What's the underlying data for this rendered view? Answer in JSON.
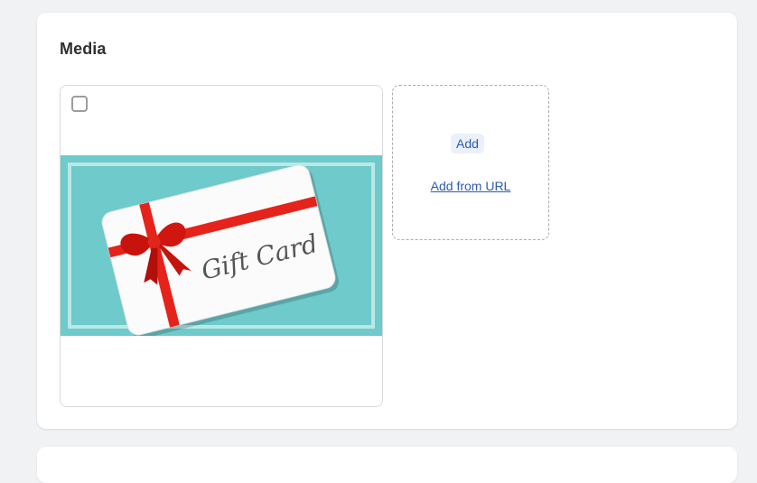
{
  "section": {
    "title": "Media"
  },
  "media": {
    "image_text": "Gift Card",
    "colors": {
      "background": "#6ecacb",
      "border_line": "#b8e6e6",
      "card": "#ffffff",
      "ribbon": "#e5231b"
    }
  },
  "dropzone": {
    "add_label": "Add",
    "add_from_url_label": "Add from URL"
  }
}
